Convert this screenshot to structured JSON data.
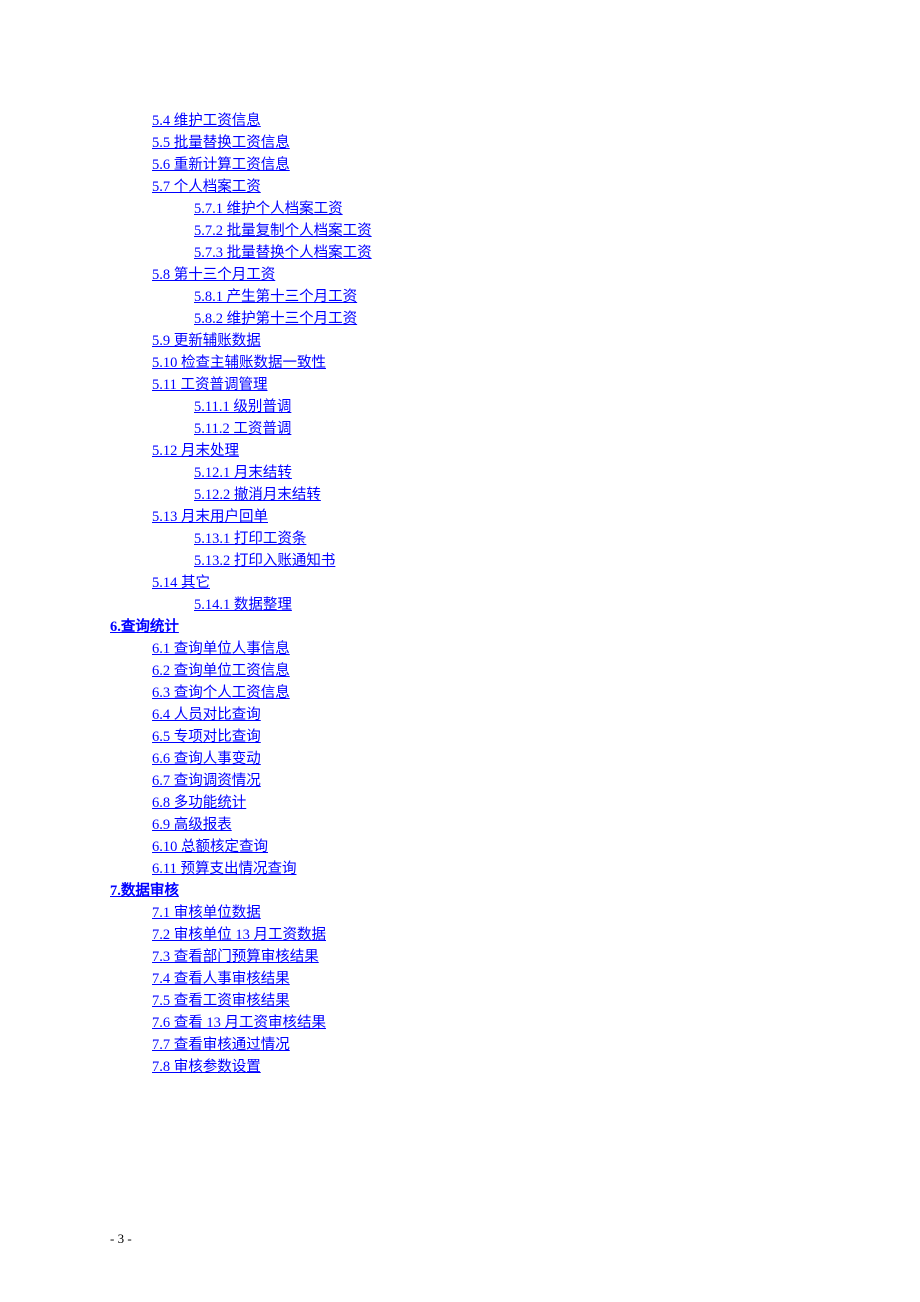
{
  "toc": [
    {
      "level": 2,
      "bold": false,
      "text": "5.4 维护工资信息"
    },
    {
      "level": 2,
      "bold": false,
      "text": "5.5 批量替换工资信息"
    },
    {
      "level": 2,
      "bold": false,
      "text": "5.6 重新计算工资信息"
    },
    {
      "level": 2,
      "bold": false,
      "text": "5.7 个人档案工资"
    },
    {
      "level": 3,
      "bold": false,
      "text": "5.7.1 维护个人档案工资"
    },
    {
      "level": 3,
      "bold": false,
      "text": "5.7.2 批量复制个人档案工资"
    },
    {
      "level": 3,
      "bold": false,
      "text": "5.7.3 批量替换个人档案工资"
    },
    {
      "level": 2,
      "bold": false,
      "text": "5.8 第十三个月工资"
    },
    {
      "level": 3,
      "bold": false,
      "text": "5.8.1 产生第十三个月工资"
    },
    {
      "level": 3,
      "bold": false,
      "text": "5.8.2 维护第十三个月工资"
    },
    {
      "level": 2,
      "bold": false,
      "text": "5.9 更新辅账数据"
    },
    {
      "level": 2,
      "bold": false,
      "text": "5.10 检查主辅账数据一致性"
    },
    {
      "level": 2,
      "bold": false,
      "text": "5.11 工资普调管理"
    },
    {
      "level": 3,
      "bold": false,
      "text": "5.11.1 级别普调"
    },
    {
      "level": 3,
      "bold": false,
      "text": "5.11.2 工资普调"
    },
    {
      "level": 2,
      "bold": false,
      "text": "5.12 月末处理"
    },
    {
      "level": 3,
      "bold": false,
      "text": "5.12.1 月末结转"
    },
    {
      "level": 3,
      "bold": false,
      "text": "5.12.2 撤消月末结转"
    },
    {
      "level": 2,
      "bold": false,
      "text": "5.13 月末用户回单"
    },
    {
      "level": 3,
      "bold": false,
      "text": "5.13.1 打印工资条"
    },
    {
      "level": 3,
      "bold": false,
      "text": "5.13.2 打印入账通知书"
    },
    {
      "level": 2,
      "bold": false,
      "text": "5.14 其它"
    },
    {
      "level": 3,
      "bold": false,
      "text": "5.14.1 数据整理"
    },
    {
      "level": 1,
      "bold": true,
      "text": "6.查询统计"
    },
    {
      "level": 2,
      "bold": false,
      "text": "6.1 查询单位人事信息"
    },
    {
      "level": 2,
      "bold": false,
      "text": "6.2 查询单位工资信息"
    },
    {
      "level": 2,
      "bold": false,
      "text": "6.3 查询个人工资信息"
    },
    {
      "level": 2,
      "bold": false,
      "text": "6.4 人员对比查询"
    },
    {
      "level": 2,
      "bold": false,
      "text": "6.5 专项对比查询"
    },
    {
      "level": 2,
      "bold": false,
      "text": "6.6 查询人事变动"
    },
    {
      "level": 2,
      "bold": false,
      "text": "6.7 查询调资情况"
    },
    {
      "level": 2,
      "bold": false,
      "text": "6.8 多功能统计"
    },
    {
      "level": 2,
      "bold": false,
      "text": "6.9 高级报表"
    },
    {
      "level": 2,
      "bold": false,
      "text": "6.10 总额核定查询"
    },
    {
      "level": 2,
      "bold": false,
      "text": "6.11 预算支出情况查询"
    },
    {
      "level": 1,
      "bold": true,
      "text": "7.数据审核"
    },
    {
      "level": 2,
      "bold": false,
      "text": "7.1 审核单位数据"
    },
    {
      "level": 2,
      "bold": false,
      "text": "7.2 审核单位 13 月工资数据"
    },
    {
      "level": 2,
      "bold": false,
      "text": "7.3 查看部门预算审核结果"
    },
    {
      "level": 2,
      "bold": false,
      "text": "7.4 查看人事审核结果"
    },
    {
      "level": 2,
      "bold": false,
      "text": "7.5 查看工资审核结果"
    },
    {
      "level": 2,
      "bold": false,
      "text": "7.6 查看 13 月工资审核结果"
    },
    {
      "level": 2,
      "bold": false,
      "text": "7.7 查看审核通过情况"
    },
    {
      "level": 2,
      "bold": false,
      "text": "7.8 审核参数设置"
    }
  ],
  "page_number": "- 3 -"
}
